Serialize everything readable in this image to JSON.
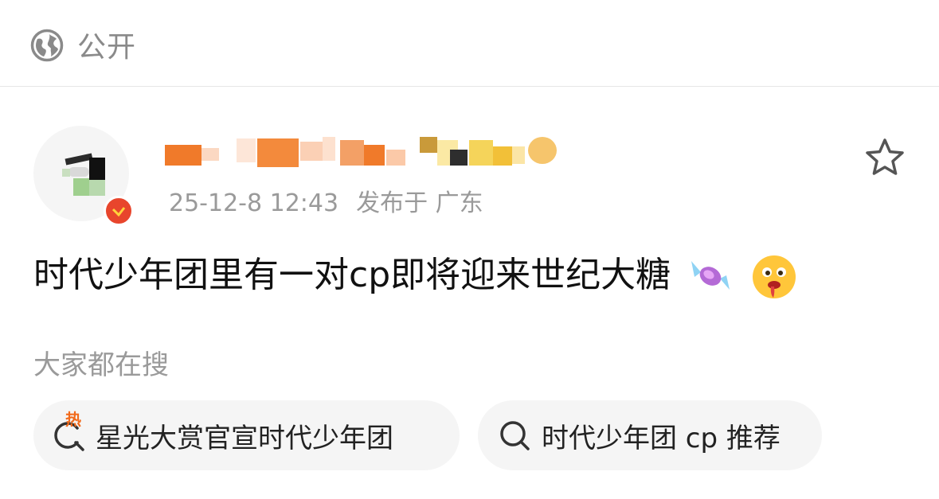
{
  "header": {
    "visibility_label": "公开",
    "visibility_icon": "globe-icon"
  },
  "post": {
    "author": {
      "verified": true,
      "badge_color": "#e8452c"
    },
    "timestamp": "25-12-8 12:43",
    "location": "发布于 广东",
    "text": "时代少年团里有一对cp即将迎来世纪大糖",
    "emojis": [
      "candy-emoji",
      "drooling-face-emoji"
    ]
  },
  "search": {
    "heading": "大家都在搜",
    "hot_tag": "热",
    "suggestions": [
      {
        "label": "星光大赏官宣时代少年团",
        "icon": "hot-search-icon"
      },
      {
        "label": "时代少年团 cp 推荐",
        "icon": "search-icon"
      }
    ]
  },
  "colors": {
    "accent_orange": "#f26a1b",
    "muted_text": "#9a9a9a",
    "chip_bg": "#f5f5f5"
  }
}
